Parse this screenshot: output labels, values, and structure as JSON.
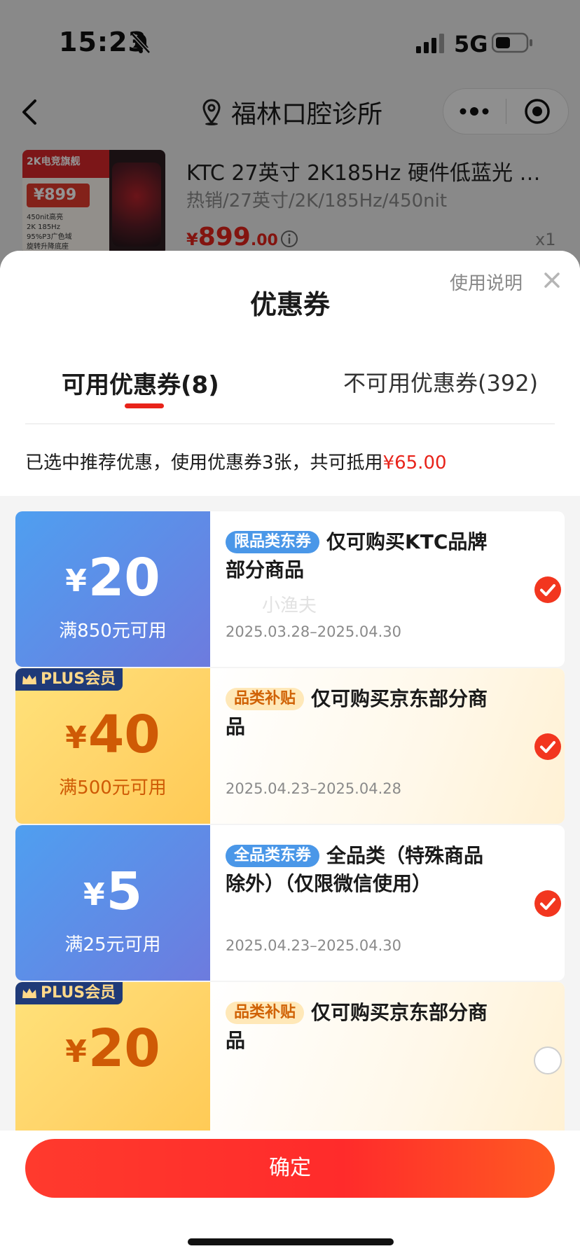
{
  "status_bar": {
    "time": "15:23",
    "network": "5G"
  },
  "nav": {
    "title": "福林口腔诊所"
  },
  "product": {
    "name": "KTC 27英寸 2K185Hz 硬件低蓝光 …",
    "spec": "热销/27英寸/2K/185Hz/450nit",
    "price_symbol": "¥",
    "price_int": "899",
    "price_dec": ".00",
    "qty": "x1",
    "thumb_top": "2K电竞旗舰",
    "thumb_price": "¥899",
    "thumb_line1": "450nit高亮",
    "thumb_line2": "2K 185Hz",
    "thumb_line3": "95%P3广色域",
    "thumb_line4": "旋转升降底座"
  },
  "sheet": {
    "title": "优惠券",
    "help": "使用说明",
    "tab_available": "可用优惠券(8)",
    "tab_unavailable": "不可用优惠券(392)",
    "summary_text": "已选中推荐优惠，使用优惠券3张，共可抵用",
    "summary_amount": "¥65.00"
  },
  "coupons": [
    {
      "style": "blue",
      "currency": "¥",
      "amount": "20",
      "threshold": "满850元可用",
      "tag": "限品类东券",
      "desc": "仅可购买KTC品牌部分商品",
      "date": "2025.03.28–2025.04.30",
      "watermark": "小渔夫",
      "plus": "",
      "selected": true
    },
    {
      "style": "gold",
      "currency": "¥",
      "amount": "40",
      "threshold": "满500元可用",
      "tag": "品类补贴",
      "desc": "仅可购买京东部分商品",
      "date": "2025.04.23–2025.04.28",
      "plus": "PLUS会员",
      "selected": true
    },
    {
      "style": "blue",
      "currency": "¥",
      "amount": "5",
      "threshold": "满25元可用",
      "tag": "全品类东券",
      "desc": "全品类（特殊商品除外）（仅限微信使用）",
      "date": "2025.04.23–2025.04.30",
      "plus": "",
      "selected": true
    },
    {
      "style": "gold",
      "currency": "¥",
      "amount": "20",
      "threshold": "",
      "tag": "品类补贴",
      "desc": "仅可购买京东部分商品",
      "date": "",
      "plus": "PLUS会员",
      "selected": false
    }
  ],
  "footer": {
    "confirm": "确定"
  },
  "colors": {
    "accent": "#e8231a",
    "coupon_blue": "#5b8fe6",
    "coupon_gold": "#ffd56b"
  }
}
